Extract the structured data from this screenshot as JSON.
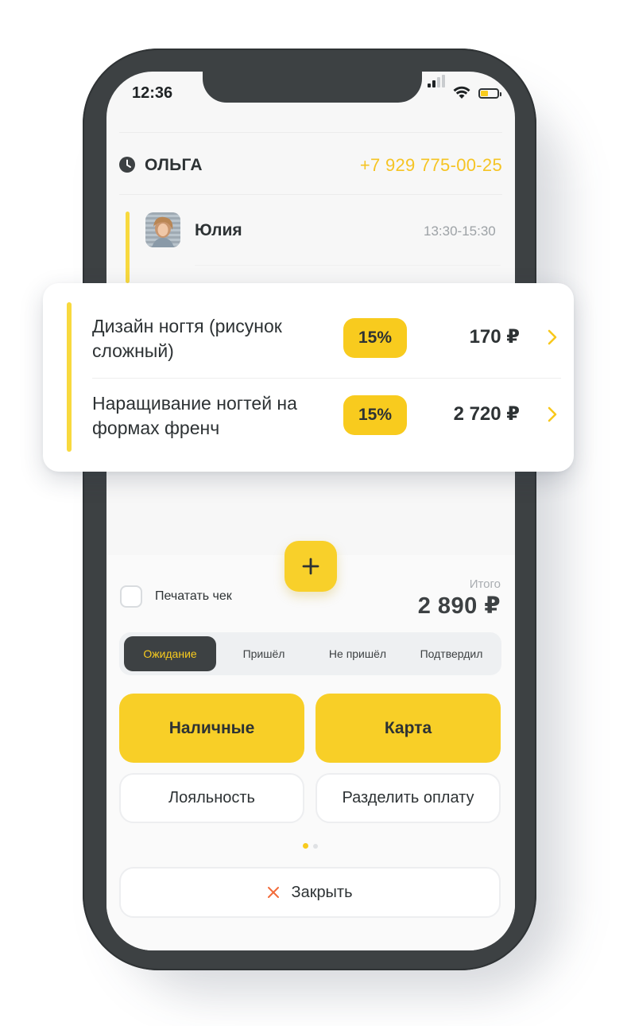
{
  "status_bar": {
    "time": "12:36"
  },
  "client": {
    "name": "ОЛЬГА",
    "phone": "+7 929 775-00-25"
  },
  "master": {
    "name": "Юлия",
    "time": "13:30-15:30"
  },
  "services": [
    {
      "name": "Дизайн ногтя (рисунок сложный)",
      "discount": "15%",
      "price": "170 ₽"
    },
    {
      "name": "Наращивание ногтей на формах френч",
      "discount": "15%",
      "price": "2 720 ₽"
    }
  ],
  "print_receipt": {
    "label": "Печатать чек",
    "checked": false
  },
  "total": {
    "label": "Итого",
    "value": "2 890 ₽"
  },
  "status_tabs": [
    {
      "label": "Ожидание",
      "active": true
    },
    {
      "label": "Пришёл",
      "active": false
    },
    {
      "label": "Не пришёл",
      "active": false
    },
    {
      "label": "Подтвердил",
      "active": false
    }
  ],
  "payment": {
    "cash_label": "Наличные",
    "card_label": "Карта",
    "loyalty_label": "Лояльность",
    "split_label": "Разделить оплату"
  },
  "pagination": {
    "current": 1,
    "total": 2
  },
  "close": {
    "label": "Закрыть"
  },
  "colors": {
    "accent": "#f8cb1e",
    "dark": "#3d4143",
    "phone_text": "#f5c424"
  },
  "icons": [
    "clock-icon",
    "signal-icon",
    "wifi-icon",
    "battery-icon",
    "chevron-right-icon",
    "plus-icon",
    "close-icon"
  ]
}
